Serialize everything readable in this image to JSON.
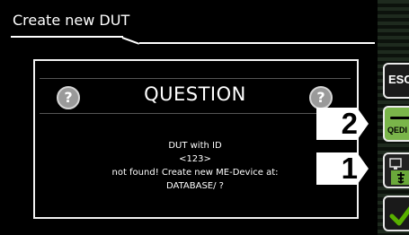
{
  "window": {
    "title": "Create new DUT"
  },
  "dialog": {
    "title": "QUESTION",
    "message_lines": [
      "DUT with ID",
      "<123>",
      "not found! Create new ME-Device at:",
      "DATABASE/ ?"
    ]
  },
  "softkeys": {
    "esc_label": "ESC",
    "qedit_label": "QEDI",
    "db_icon": "database-device-icon",
    "ok_icon": "checkmark-icon"
  },
  "callouts": {
    "first": "1",
    "second": "2"
  },
  "colors": {
    "qedit_green": "#7ab54a",
    "ok_green": "#58b000"
  }
}
